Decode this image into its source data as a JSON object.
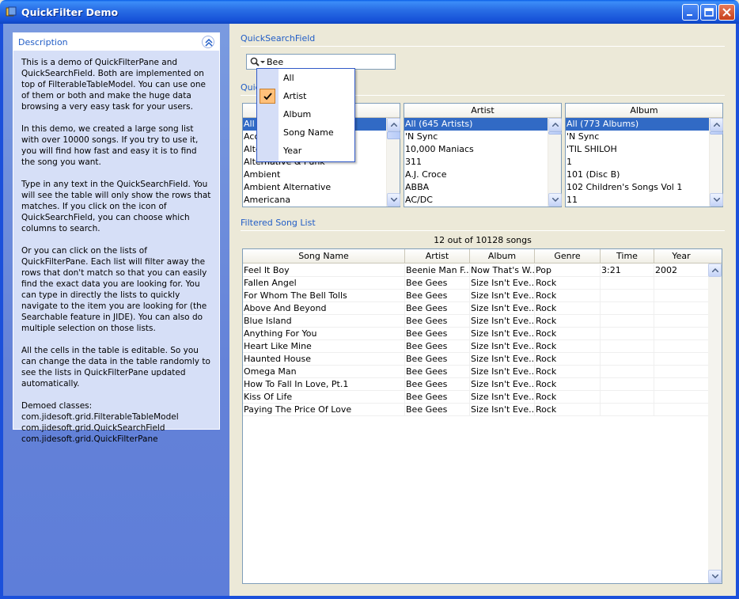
{
  "window": {
    "title": "QuickFilter Demo"
  },
  "description": {
    "header": "Description",
    "paragraphs": [
      "This is a demo of QuickFilterPane and QuickSearchField. Both are implemented on top of FilterableTableModel. You can use one of them or both and make the huge data browsing a very easy task for your users.",
      "In this demo, we created a large song list with over 10000 songs. If you try to use it, you will find how fast and easy it is to find the song you want.",
      "Type in any text in the QuickSearchField. You will see the table will only show the rows that matches. If you click on the icon of QuickSearchField, you can choose which columns to search.",
      "Or you can click on the lists of QuickFilterPane. Each list will filter away the rows that don't match so that you can easily find the exact data you are looking for. You can type in directly the lists to quickly navigate to the item you are looking for (the Searchable feature in JIDE). You can also do multiple selection on those lists.",
      "All the cells in the table is editable. So you can change the data in the table randomly to see the lists in QuickFilterPane updated automatically."
    ],
    "classes_title": "Demoed classes:",
    "classes": [
      "com.jidesoft.grid.FilterableTableModel",
      "com.jidesoft.grid.QuickSearchField",
      "com.jidesoft.grid.QuickFilterPane"
    ]
  },
  "quick_search": {
    "label": "QuickSearchField",
    "value": "Bee"
  },
  "quick_filter": {
    "label": "Quic",
    "lists": [
      {
        "header": "",
        "items": [
          "All",
          "Acc",
          "Alte",
          "Alternative & Punk",
          "Ambient",
          "Ambient Alternative",
          "Americana"
        ]
      },
      {
        "header": "Artist",
        "items": [
          "All (645 Artists)",
          "'N Sync",
          "10,000 Maniacs",
          "311",
          "A.J. Croce",
          "ABBA",
          "AC/DC"
        ]
      },
      {
        "header": "Album",
        "items": [
          "All (773 Albums)",
          "'N Sync",
          "'TIL SHILOH",
          "1",
          "101 (Disc B)",
          "102 Children's Songs Vol 1",
          "11"
        ]
      }
    ]
  },
  "popup_menu": {
    "items": [
      "All",
      "Artist",
      "Album",
      "Song Name",
      "Year"
    ],
    "checked_index": 1
  },
  "song_list": {
    "label": "Filtered Song List",
    "count_text": "12 out of 10128 songs",
    "columns": [
      "Song Name",
      "Artist",
      "Album",
      "Genre",
      "Time",
      "Year"
    ],
    "rows": [
      [
        "Feel It Boy",
        "Beenie Man F...",
        "Now That's W...",
        "Pop",
        "3:21",
        "2002"
      ],
      [
        "Fallen Angel",
        "Bee Gees",
        "Size Isn't Eve...",
        "Rock",
        "",
        ""
      ],
      [
        "For Whom The Bell Tolls",
        "Bee Gees",
        "Size Isn't Eve...",
        "Rock",
        "",
        ""
      ],
      [
        "Above And Beyond",
        "Bee Gees",
        "Size Isn't Eve...",
        "Rock",
        "",
        ""
      ],
      [
        "Blue Island",
        "Bee Gees",
        "Size Isn't Eve...",
        "Rock",
        "",
        ""
      ],
      [
        "Anything For You",
        "Bee Gees",
        "Size Isn't Eve...",
        "Rock",
        "",
        ""
      ],
      [
        "Heart Like Mine",
        "Bee Gees",
        "Size Isn't Eve...",
        "Rock",
        "",
        ""
      ],
      [
        "Haunted House",
        "Bee Gees",
        "Size Isn't Eve...",
        "Rock",
        "",
        ""
      ],
      [
        "Omega Man",
        "Bee Gees",
        "Size Isn't Eve...",
        "Rock",
        "",
        ""
      ],
      [
        "How To Fall In Love, Pt.1",
        "Bee Gees",
        "Size Isn't Eve...",
        "Rock",
        "",
        ""
      ],
      [
        "Kiss Of Life",
        "Bee Gees",
        "Size Isn't Eve...",
        "Rock",
        "",
        ""
      ],
      [
        "Paying The Price Of Love",
        "Bee Gees",
        "Size Isn't Eve...",
        "Rock",
        "",
        ""
      ]
    ]
  },
  "colors": {
    "titlebar": "#2A6FE6",
    "selection": "#316AC5",
    "section_label": "#215DC6",
    "side_panel": "#6482D8",
    "menu_check": "#FFC07A"
  },
  "icons": [
    "app-icon",
    "minimize-icon",
    "maximize-icon",
    "close-icon",
    "collapse-up-icon",
    "search-icon",
    "dropdown-caret-icon",
    "checkmark-icon",
    "scroll-up-icon",
    "scroll-down-icon"
  ]
}
